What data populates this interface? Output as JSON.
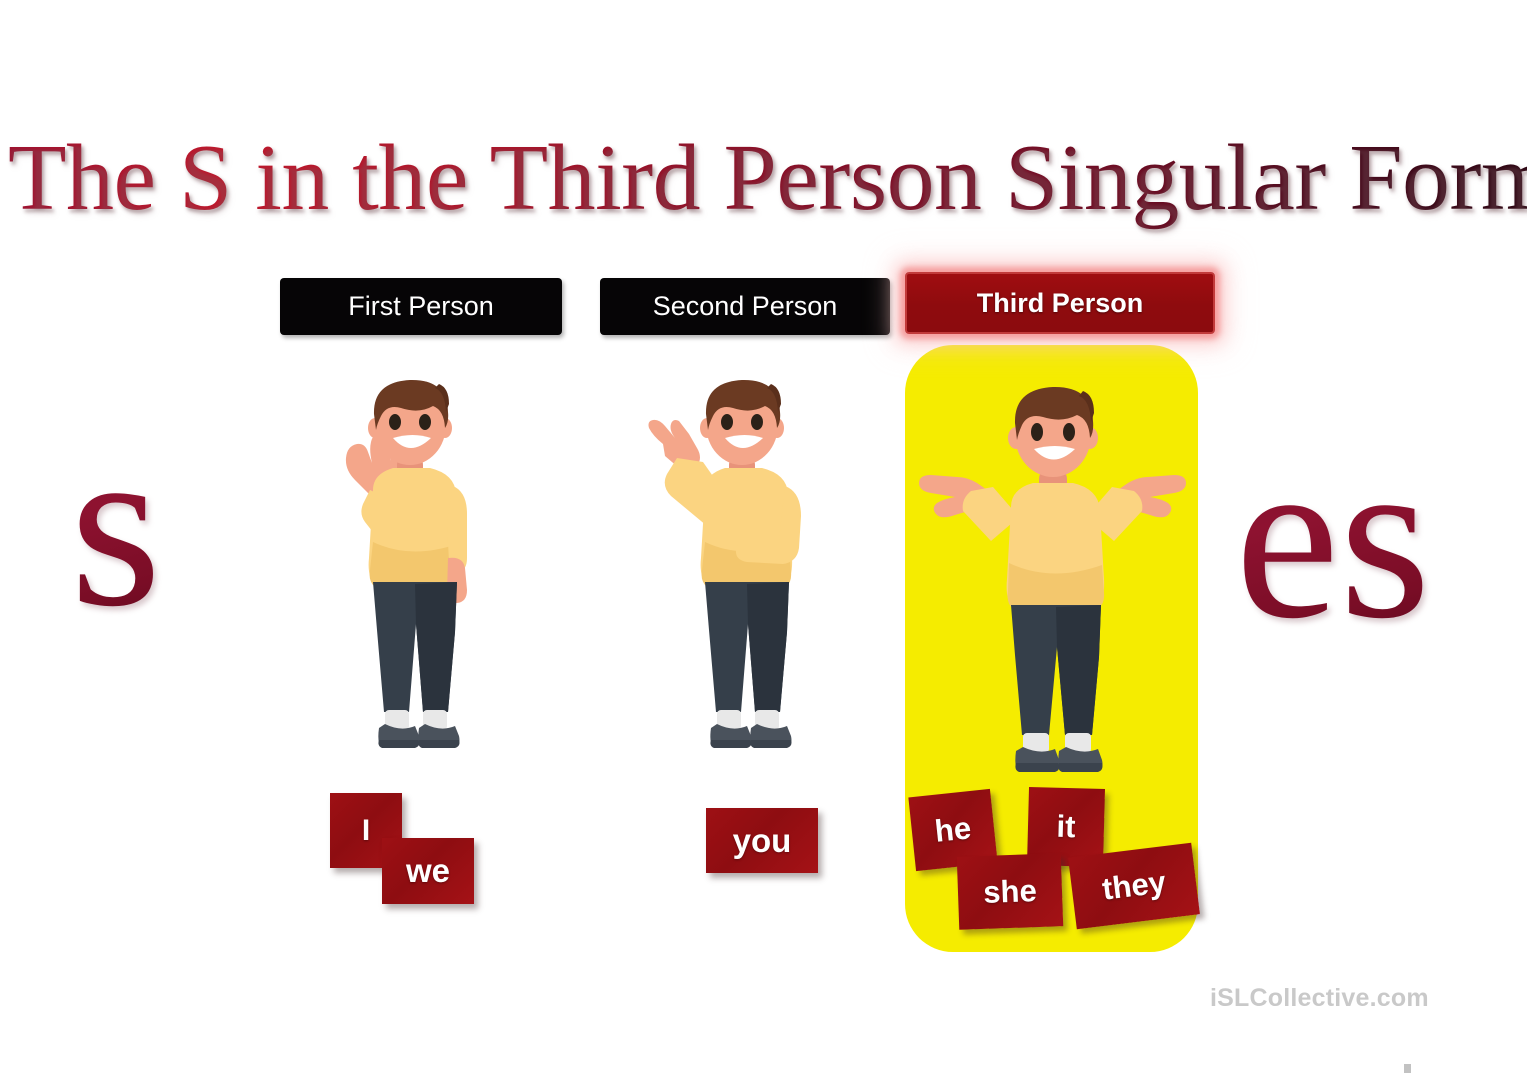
{
  "page": {
    "title": "The S in the Third Person Singular Form",
    "background_color": "#ffffff"
  },
  "suffixes": {
    "left": "s",
    "right": "es",
    "color": "#8c1230"
  },
  "columns": [
    {
      "id": "first",
      "header_label": "First Person",
      "header_style": "black",
      "header_bg": "#060506",
      "highlighted": false,
      "figure_pose": "waving",
      "cards": [
        "I",
        "we"
      ]
    },
    {
      "id": "second",
      "header_label": "Second Person",
      "header_style": "black",
      "header_bg": "#060506",
      "highlighted": false,
      "figure_pose": "pointing",
      "cards": [
        "you"
      ]
    },
    {
      "id": "third",
      "header_label": "Third Person",
      "header_style": "red-glow",
      "header_bg": "#8e0b0e",
      "highlighted": true,
      "highlight_color": "#f5ec00",
      "figure_pose": "shrugging",
      "cards": [
        "he",
        "it",
        "she",
        "they"
      ]
    }
  ],
  "cards": {
    "i": "I",
    "we": "we",
    "you": "you",
    "he": "he",
    "it": "it",
    "she": "she",
    "they": "they",
    "bg_color": "#9e1014",
    "text_color": "#ffffff"
  },
  "figure_colors": {
    "hair": "#6b3a22",
    "hair_shadow": "#5a2f1b",
    "skin": "#f4a68a",
    "skin_shadow": "#e8937a",
    "sweater": "#fbd481",
    "sweater_shadow": "#f3c76d",
    "jeans": "#353f4a",
    "jeans_shadow": "#2b333d",
    "shoes": "#4a525c",
    "shoes_dark": "#3b434d",
    "socks": "#e8e8e8",
    "eyes": "#2b2118",
    "mouth": "#ffffff"
  },
  "watermark": {
    "text": "iSLCollective.com",
    "color": "#c9c9c9"
  }
}
